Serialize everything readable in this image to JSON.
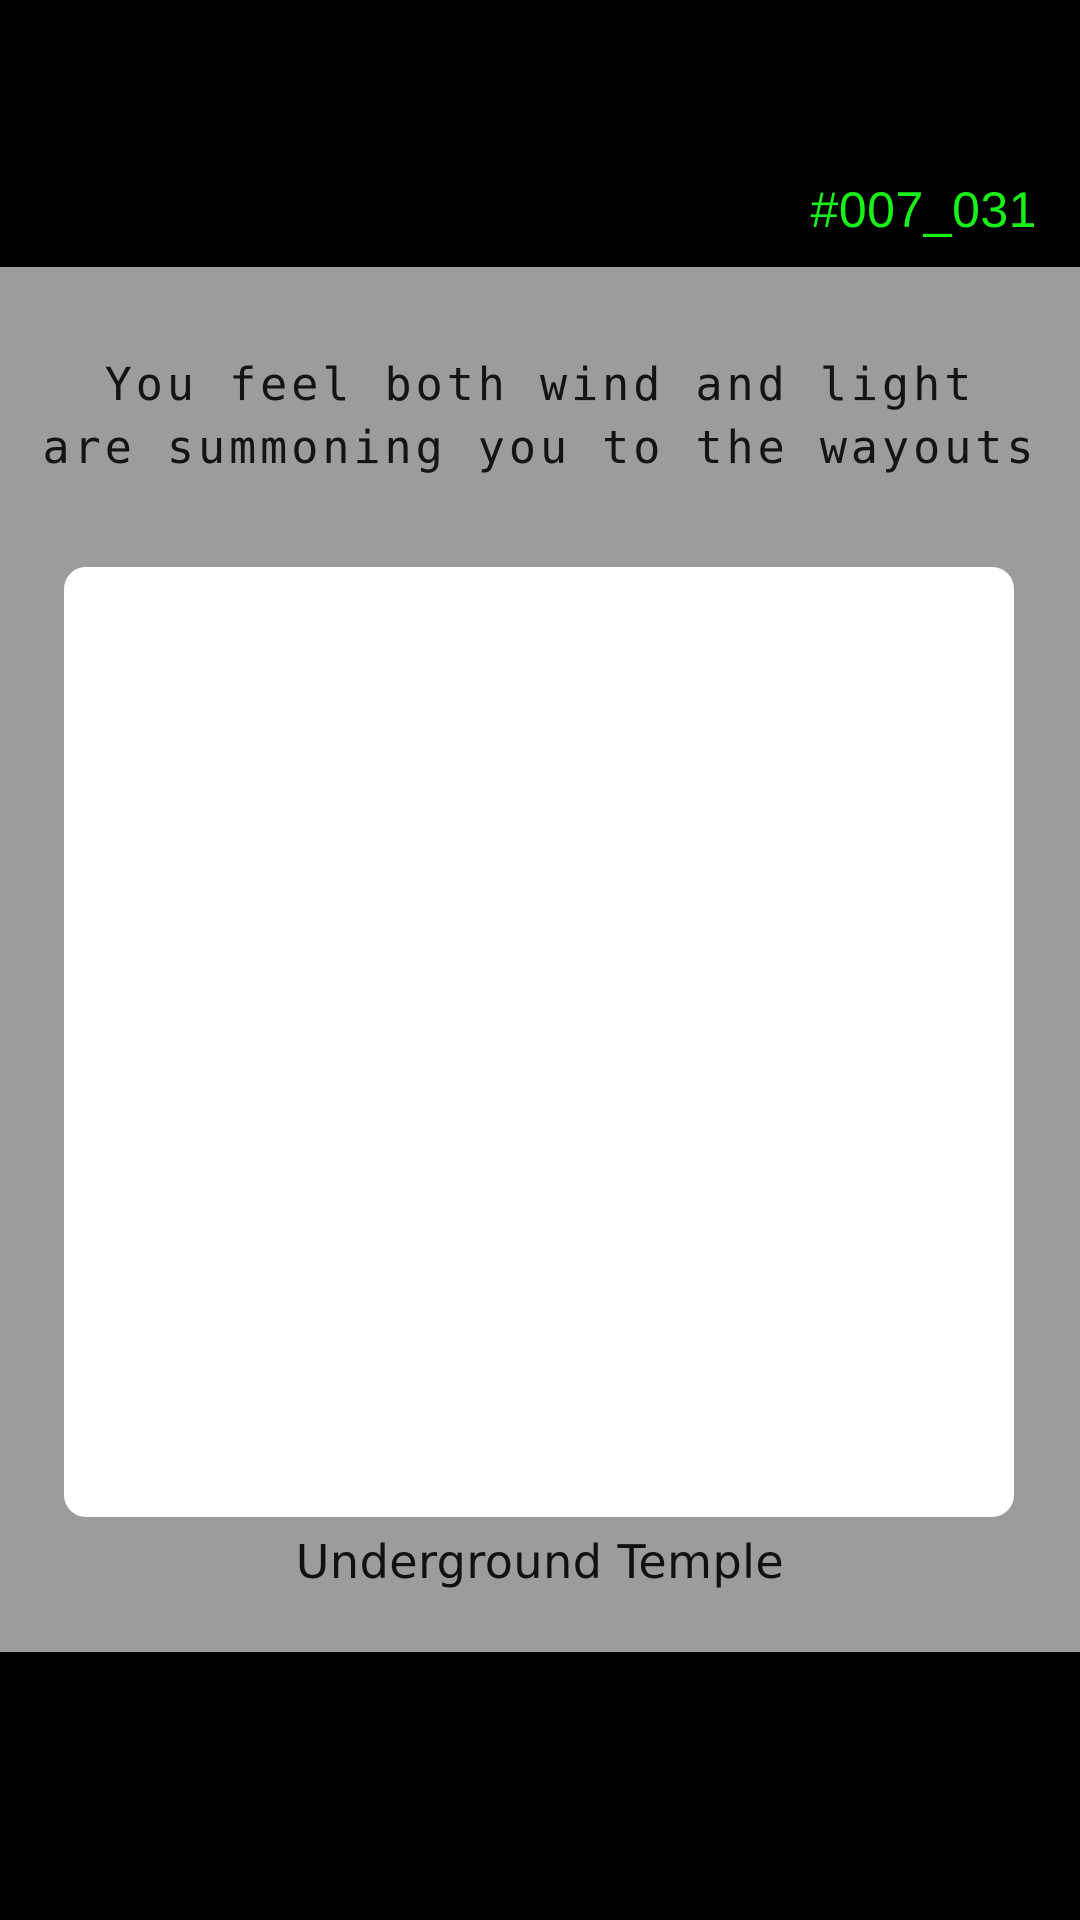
{
  "header": {
    "level_code": "#007_031"
  },
  "message": {
    "lines": [
      "You feel both wind and light",
      "are summoning you to the wayouts"
    ]
  },
  "room": {
    "name": "Underground Temple"
  },
  "colors": {
    "background": "#000000",
    "panel": "#9c9c9c",
    "level_code": "#19f219",
    "room_frame": "#ffffff",
    "text": "#141414"
  }
}
